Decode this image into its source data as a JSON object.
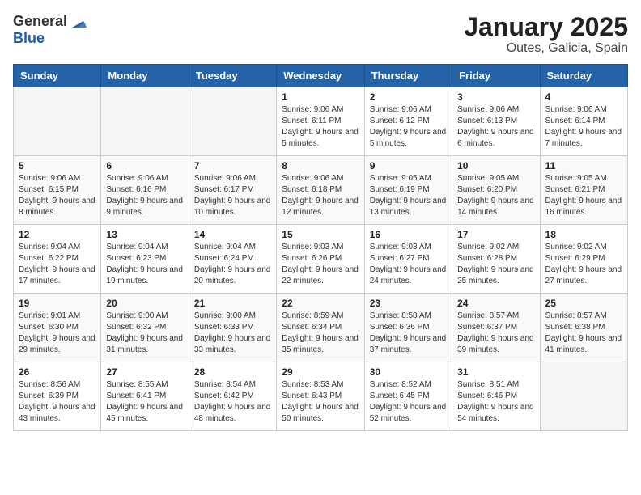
{
  "logo": {
    "general": "General",
    "blue": "Blue"
  },
  "title": "January 2025",
  "subtitle": "Outes, Galicia, Spain",
  "weekdays": [
    "Sunday",
    "Monday",
    "Tuesday",
    "Wednesday",
    "Thursday",
    "Friday",
    "Saturday"
  ],
  "weeks": [
    [
      {
        "day": "",
        "info": ""
      },
      {
        "day": "",
        "info": ""
      },
      {
        "day": "",
        "info": ""
      },
      {
        "day": "1",
        "info": "Sunrise: 9:06 AM\nSunset: 6:11 PM\nDaylight: 9 hours and 5 minutes."
      },
      {
        "day": "2",
        "info": "Sunrise: 9:06 AM\nSunset: 6:12 PM\nDaylight: 9 hours and 5 minutes."
      },
      {
        "day": "3",
        "info": "Sunrise: 9:06 AM\nSunset: 6:13 PM\nDaylight: 9 hours and 6 minutes."
      },
      {
        "day": "4",
        "info": "Sunrise: 9:06 AM\nSunset: 6:14 PM\nDaylight: 9 hours and 7 minutes."
      }
    ],
    [
      {
        "day": "5",
        "info": "Sunrise: 9:06 AM\nSunset: 6:15 PM\nDaylight: 9 hours and 8 minutes."
      },
      {
        "day": "6",
        "info": "Sunrise: 9:06 AM\nSunset: 6:16 PM\nDaylight: 9 hours and 9 minutes."
      },
      {
        "day": "7",
        "info": "Sunrise: 9:06 AM\nSunset: 6:17 PM\nDaylight: 9 hours and 10 minutes."
      },
      {
        "day": "8",
        "info": "Sunrise: 9:06 AM\nSunset: 6:18 PM\nDaylight: 9 hours and 12 minutes."
      },
      {
        "day": "9",
        "info": "Sunrise: 9:05 AM\nSunset: 6:19 PM\nDaylight: 9 hours and 13 minutes."
      },
      {
        "day": "10",
        "info": "Sunrise: 9:05 AM\nSunset: 6:20 PM\nDaylight: 9 hours and 14 minutes."
      },
      {
        "day": "11",
        "info": "Sunrise: 9:05 AM\nSunset: 6:21 PM\nDaylight: 9 hours and 16 minutes."
      }
    ],
    [
      {
        "day": "12",
        "info": "Sunrise: 9:04 AM\nSunset: 6:22 PM\nDaylight: 9 hours and 17 minutes."
      },
      {
        "day": "13",
        "info": "Sunrise: 9:04 AM\nSunset: 6:23 PM\nDaylight: 9 hours and 19 minutes."
      },
      {
        "day": "14",
        "info": "Sunrise: 9:04 AM\nSunset: 6:24 PM\nDaylight: 9 hours and 20 minutes."
      },
      {
        "day": "15",
        "info": "Sunrise: 9:03 AM\nSunset: 6:26 PM\nDaylight: 9 hours and 22 minutes."
      },
      {
        "day": "16",
        "info": "Sunrise: 9:03 AM\nSunset: 6:27 PM\nDaylight: 9 hours and 24 minutes."
      },
      {
        "day": "17",
        "info": "Sunrise: 9:02 AM\nSunset: 6:28 PM\nDaylight: 9 hours and 25 minutes."
      },
      {
        "day": "18",
        "info": "Sunrise: 9:02 AM\nSunset: 6:29 PM\nDaylight: 9 hours and 27 minutes."
      }
    ],
    [
      {
        "day": "19",
        "info": "Sunrise: 9:01 AM\nSunset: 6:30 PM\nDaylight: 9 hours and 29 minutes."
      },
      {
        "day": "20",
        "info": "Sunrise: 9:00 AM\nSunset: 6:32 PM\nDaylight: 9 hours and 31 minutes."
      },
      {
        "day": "21",
        "info": "Sunrise: 9:00 AM\nSunset: 6:33 PM\nDaylight: 9 hours and 33 minutes."
      },
      {
        "day": "22",
        "info": "Sunrise: 8:59 AM\nSunset: 6:34 PM\nDaylight: 9 hours and 35 minutes."
      },
      {
        "day": "23",
        "info": "Sunrise: 8:58 AM\nSunset: 6:36 PM\nDaylight: 9 hours and 37 minutes."
      },
      {
        "day": "24",
        "info": "Sunrise: 8:57 AM\nSunset: 6:37 PM\nDaylight: 9 hours and 39 minutes."
      },
      {
        "day": "25",
        "info": "Sunrise: 8:57 AM\nSunset: 6:38 PM\nDaylight: 9 hours and 41 minutes."
      }
    ],
    [
      {
        "day": "26",
        "info": "Sunrise: 8:56 AM\nSunset: 6:39 PM\nDaylight: 9 hours and 43 minutes."
      },
      {
        "day": "27",
        "info": "Sunrise: 8:55 AM\nSunset: 6:41 PM\nDaylight: 9 hours and 45 minutes."
      },
      {
        "day": "28",
        "info": "Sunrise: 8:54 AM\nSunset: 6:42 PM\nDaylight: 9 hours and 48 minutes."
      },
      {
        "day": "29",
        "info": "Sunrise: 8:53 AM\nSunset: 6:43 PM\nDaylight: 9 hours and 50 minutes."
      },
      {
        "day": "30",
        "info": "Sunrise: 8:52 AM\nSunset: 6:45 PM\nDaylight: 9 hours and 52 minutes."
      },
      {
        "day": "31",
        "info": "Sunrise: 8:51 AM\nSunset: 6:46 PM\nDaylight: 9 hours and 54 minutes."
      },
      {
        "day": "",
        "info": ""
      }
    ]
  ]
}
